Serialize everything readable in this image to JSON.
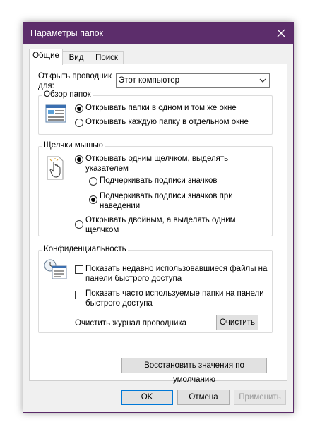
{
  "window": {
    "title": "Параметры папок"
  },
  "tabs": [
    {
      "label": "Общие"
    },
    {
      "label": "Вид"
    },
    {
      "label": "Поиск"
    }
  ],
  "open_explorer": {
    "label": "Открыть проводник для:",
    "value": "Этот компьютер"
  },
  "browse_folders": {
    "label": "Обзор папок",
    "options": [
      {
        "label": "Открывать папки в одном и том же окне",
        "selected": true
      },
      {
        "label": "Открывать каждую папку в отдельном окне",
        "selected": false
      }
    ]
  },
  "click_items": {
    "label": "Щелчки мышью",
    "single_click": "Открывать одним щелчком, выделять указателем",
    "underline_options": [
      {
        "label": "Подчеркивать подписи значков",
        "selected": false
      },
      {
        "label": "Подчеркивать подписи значков при наведении",
        "selected": true
      }
    ],
    "double_click": "Открывать двойным, а выделять одним щелчком"
  },
  "privacy": {
    "label": "Конфиденциальность",
    "show_recent_files": "Показать недавно использовавшиеся файлы на панели быстрого доступа",
    "show_frequent_folders": "Показать часто используемые папки на панели быстрого доступа",
    "clear_history_label": "Очистить журнал проводника",
    "clear_button": "Очистить"
  },
  "restore_defaults": "Восстановить значения по умолчанию",
  "buttons": {
    "ok": "OK",
    "cancel": "Отмена",
    "apply": "Применить"
  }
}
